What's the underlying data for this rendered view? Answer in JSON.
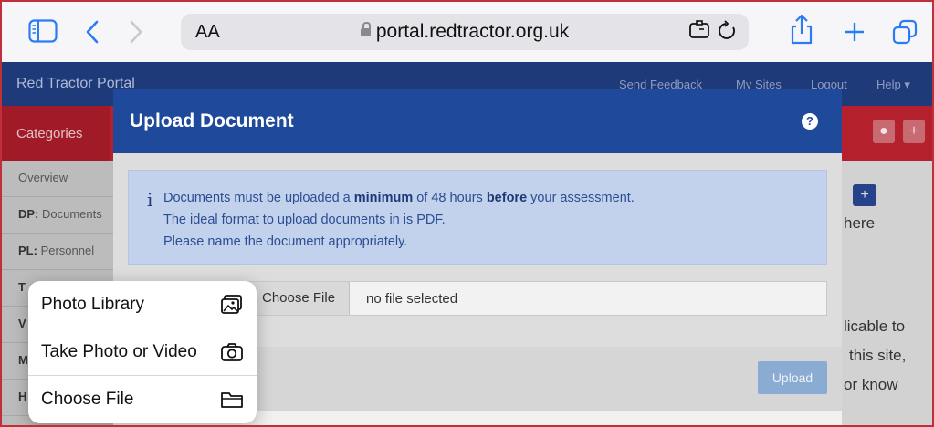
{
  "browser": {
    "text_size_label": "AA",
    "url": "portal.redtractor.org.uk"
  },
  "portal": {
    "brand": "Red Tractor Portal",
    "nav": [
      "Send Feedback",
      "My Sites",
      "Logout",
      "Help"
    ],
    "categories_label": "Categories",
    "sidebar": [
      {
        "prefix": "",
        "label": "Overview"
      },
      {
        "prefix": "DP:",
        "label": " Documents"
      },
      {
        "prefix": "PL:",
        "label": " Personnel"
      },
      {
        "prefix": "T",
        "label": ""
      },
      {
        "prefix": "V",
        "label": ""
      },
      {
        "prefix": "M",
        "label": ""
      },
      {
        "prefix": "H",
        "label": ""
      }
    ],
    "right_text": {
      "here": "here",
      "line1": "licable to",
      "line2": "this site,",
      "line3": "or know"
    }
  },
  "modal": {
    "title": "Upload Document",
    "help_icon": "?",
    "info": {
      "icon": "i",
      "line1_pre": "Documents must be uploaded a ",
      "line1_b1": "minimum",
      "line1_mid": " of 48 hours ",
      "line1_b2": "before",
      "line1_post": " your assessment.",
      "line2": "The ideal format to upload documents in is PDF.",
      "line3": "Please name the document appropriately."
    },
    "choose_file_button": "Choose File",
    "no_file_text": "no file selected",
    "upload_button": "Upload"
  },
  "menu": {
    "items": [
      {
        "label": "Photo Library",
        "icon": "photo-library-icon"
      },
      {
        "label": "Take Photo or Video",
        "icon": "camera-icon"
      },
      {
        "label": "Choose File",
        "icon": "folder-icon"
      }
    ]
  },
  "colors": {
    "accent": "#2a7bf6",
    "navbar": "#1f3a79",
    "subbar": "#b5202d",
    "modal_header": "#1f4a9c",
    "info_bg": "#c3d2ec"
  }
}
